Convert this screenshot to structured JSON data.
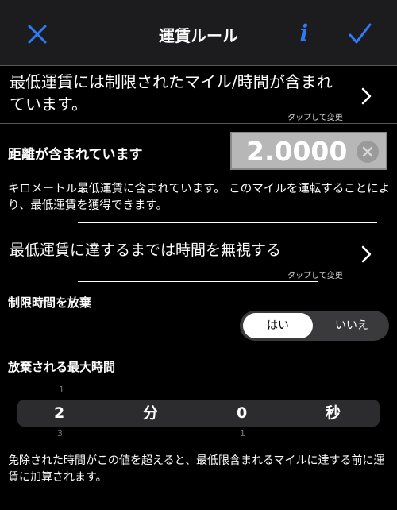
{
  "nav": {
    "title": "運賃ルール",
    "info_glyph": "i",
    "accent_color": "#2f7bf5"
  },
  "min_fare_row": {
    "text": "最低運賃には制限されたマイル/時間が含まれています。",
    "hint": "タップして変更"
  },
  "distance": {
    "label": "距離が含まれています",
    "value": "2.0000",
    "description": "キロメートル最低運賃に含まれています。 このマイルを運転することにより、最低運賃を獲得できます。"
  },
  "ignore_time_row": {
    "text": "最低運賃に達するまでは時間を無視する",
    "hint": "タップして変更"
  },
  "waive_time": {
    "label": "制限時間を放棄",
    "options": [
      "はい",
      "いいえ"
    ],
    "selected": "はい"
  },
  "max_waived": {
    "label": "放棄される最大時間",
    "picker": {
      "minutes_value": "2",
      "minutes_unit": "分",
      "seconds_value": "0",
      "seconds_unit": "秒",
      "minutes_prev": "1",
      "minutes_next": "3",
      "seconds_next": "1"
    },
    "description": "免除された時間がこの値を超えると、最低限含まれるマイルに達する前に運賃に加算されます。"
  }
}
